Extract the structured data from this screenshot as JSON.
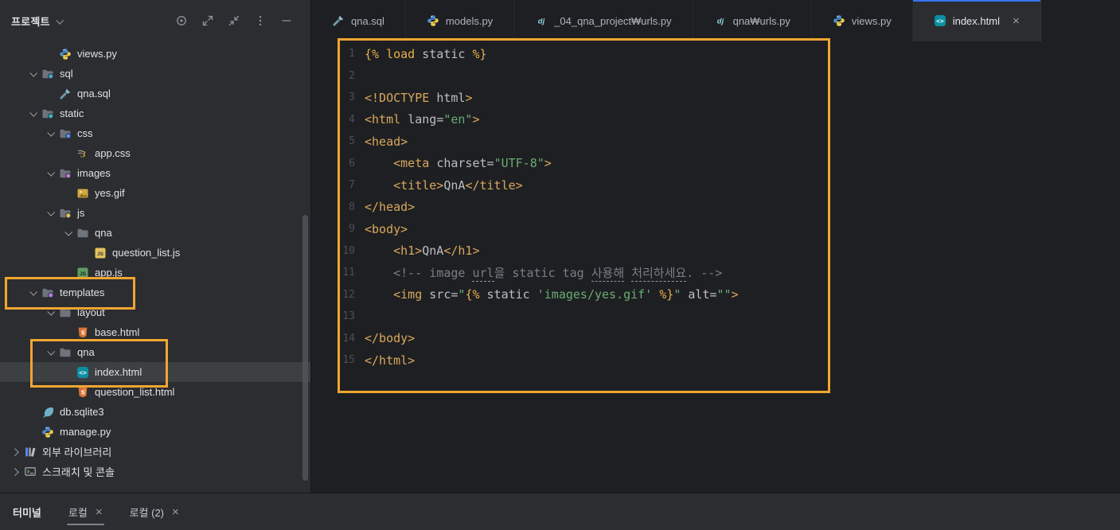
{
  "colors": {
    "highlight_box": "#f0a630",
    "accent_blue": "#3574f0",
    "selection": "#3d4043",
    "panel_bg": "#2b2d30",
    "editor_bg": "#1e1f22"
  },
  "project_panel": {
    "title": "프로젝트",
    "header_icons": [
      {
        "name": "locate-target"
      },
      {
        "name": "expand-all"
      },
      {
        "name": "collapse-all"
      },
      {
        "name": "more-options"
      },
      {
        "name": "hide-panel"
      }
    ],
    "tree": [
      {
        "label": "views.py",
        "icon": "python",
        "depth": 2
      },
      {
        "label": "sql",
        "icon": "folder-sql",
        "depth": 1,
        "chevron": "down"
      },
      {
        "label": "qna.sql",
        "icon": "pen-nib",
        "depth": 2
      },
      {
        "label": "static",
        "icon": "folder-static",
        "depth": 1,
        "chevron": "down"
      },
      {
        "label": "css",
        "icon": "folder-css",
        "depth": 2,
        "chevron": "down"
      },
      {
        "label": "app.css",
        "icon": "css3",
        "depth": 3
      },
      {
        "label": "images",
        "icon": "folder-images",
        "depth": 2,
        "chevron": "down"
      },
      {
        "label": "yes.gif",
        "icon": "image",
        "depth": 3
      },
      {
        "label": "js",
        "icon": "folder-js",
        "depth": 2,
        "chevron": "down"
      },
      {
        "label": "qna",
        "icon": "folder",
        "depth": 3,
        "chevron": "down"
      },
      {
        "label": "question_list.js",
        "icon": "js",
        "depth": 4
      },
      {
        "label": "app.js",
        "icon": "js-green",
        "depth": 3
      },
      {
        "label": "templates",
        "icon": "folder-templates",
        "depth": 1,
        "chevron": "down"
      },
      {
        "label": "layout",
        "icon": "folder",
        "depth": 2,
        "chevron": "down"
      },
      {
        "label": "base.html",
        "icon": "html5",
        "depth": 3
      },
      {
        "label": "qna",
        "icon": "folder",
        "depth": 2,
        "chevron": "down"
      },
      {
        "label": "index.html",
        "icon": "html-angle",
        "depth": 3,
        "selected": true
      },
      {
        "label": "question_list.html",
        "icon": "html5",
        "depth": 3
      },
      {
        "label": "db.sqlite3",
        "icon": "feather",
        "depth": 1
      },
      {
        "label": "manage.py",
        "icon": "python",
        "depth": 1
      },
      {
        "label": "외부 라이브러리",
        "icon": "library",
        "depth": 0,
        "chevron": "right"
      },
      {
        "label": "스크래치 및 콘솔",
        "icon": "console",
        "depth": 0,
        "chevron": "right"
      }
    ]
  },
  "editor": {
    "tabs": [
      {
        "label": "qna.sql",
        "icon": "pen-nib"
      },
      {
        "label": "models.py",
        "icon": "python"
      },
      {
        "label": "_04_qna_project₩urls.py",
        "icon": "dj"
      },
      {
        "label": "qna₩urls.py",
        "icon": "dj"
      },
      {
        "label": "views.py",
        "icon": "python"
      },
      {
        "label": "index.html",
        "icon": "html-angle",
        "active": true,
        "close": true
      }
    ],
    "lines": [
      {
        "n": 1,
        "segs": [
          {
            "t": "{% load ",
            "c": "dj"
          },
          {
            "t": "static",
            "c": "plain"
          },
          {
            "t": " %}",
            "c": "dj"
          }
        ]
      },
      {
        "n": 2,
        "segs": []
      },
      {
        "n": 3,
        "segs": [
          {
            "t": "<!DOCTYPE ",
            "c": "tag"
          },
          {
            "t": "html",
            "c": "plain"
          },
          {
            "t": ">",
            "c": "tag"
          }
        ]
      },
      {
        "n": 4,
        "segs": [
          {
            "t": "<html ",
            "c": "tag"
          },
          {
            "t": "lang",
            "c": "attr"
          },
          {
            "t": "=",
            "c": "plain"
          },
          {
            "t": "\"en\"",
            "c": "str"
          },
          {
            "t": ">",
            "c": "tag"
          }
        ]
      },
      {
        "n": 5,
        "segs": [
          {
            "t": "<head>",
            "c": "tag"
          }
        ]
      },
      {
        "n": 6,
        "segs": [
          {
            "t": "    ",
            "c": "plain"
          },
          {
            "t": "<meta ",
            "c": "tag"
          },
          {
            "t": "charset",
            "c": "attr"
          },
          {
            "t": "=",
            "c": "plain"
          },
          {
            "t": "\"UTF-8\"",
            "c": "str"
          },
          {
            "t": ">",
            "c": "tag"
          }
        ]
      },
      {
        "n": 7,
        "segs": [
          {
            "t": "    ",
            "c": "plain"
          },
          {
            "t": "<title>",
            "c": "tag"
          },
          {
            "t": "QnA",
            "c": "plain"
          },
          {
            "t": "</title>",
            "c": "tag"
          }
        ]
      },
      {
        "n": 8,
        "segs": [
          {
            "t": "</head>",
            "c": "tag"
          }
        ]
      },
      {
        "n": 9,
        "segs": [
          {
            "t": "<body>",
            "c": "tag"
          }
        ]
      },
      {
        "n": 10,
        "segs": [
          {
            "t": "    ",
            "c": "plain"
          },
          {
            "t": "<h1>",
            "c": "tag"
          },
          {
            "t": "QnA",
            "c": "plain"
          },
          {
            "t": "</h1>",
            "c": "tag"
          }
        ]
      },
      {
        "n": 11,
        "segs": [
          {
            "t": "    ",
            "c": "plain"
          },
          {
            "t": "<!-- image ",
            "c": "com"
          },
          {
            "t": "url",
            "c": "comu"
          },
          {
            "t": "을 ",
            "c": "com"
          },
          {
            "t": "static tag ",
            "c": "com"
          },
          {
            "t": "사용해",
            "c": "comu"
          },
          {
            "t": " ",
            "c": "com"
          },
          {
            "t": "처리하세요",
            "c": "comu"
          },
          {
            "t": ". -->",
            "c": "com"
          }
        ]
      },
      {
        "n": 12,
        "segs": [
          {
            "t": "    ",
            "c": "plain"
          },
          {
            "t": "<img ",
            "c": "tag"
          },
          {
            "t": "src",
            "c": "attr"
          },
          {
            "t": "=",
            "c": "plain"
          },
          {
            "t": "\"",
            "c": "str"
          },
          {
            "t": "{% ",
            "c": "dj"
          },
          {
            "t": "static ",
            "c": "plain"
          },
          {
            "t": "'images/yes.gif'",
            "c": "str"
          },
          {
            "t": " %}",
            "c": "dj"
          },
          {
            "t": "\"",
            "c": "str"
          },
          {
            "t": " ",
            "c": "plain"
          },
          {
            "t": "alt",
            "c": "attr"
          },
          {
            "t": "=",
            "c": "plain"
          },
          {
            "t": "\"\"",
            "c": "str"
          },
          {
            "t": ">",
            "c": "tag"
          }
        ]
      },
      {
        "n": 13,
        "segs": []
      },
      {
        "n": 14,
        "segs": [
          {
            "t": "</body>",
            "c": "tag"
          }
        ]
      },
      {
        "n": 15,
        "segs": [
          {
            "t": "</html>",
            "c": "tag"
          }
        ]
      }
    ]
  },
  "terminal": {
    "title": "터미널",
    "tabs": [
      {
        "label": "로컬",
        "active": true
      },
      {
        "label": "로컬 (2)",
        "active": false
      }
    ]
  }
}
